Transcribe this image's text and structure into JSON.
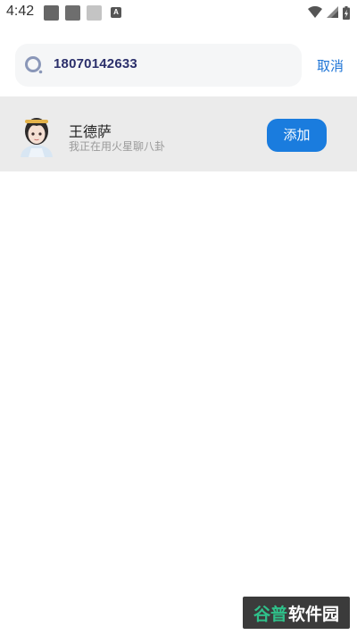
{
  "status_bar": {
    "time": "4:42",
    "notification_badge": "A"
  },
  "search": {
    "query": "18070142633",
    "cancel_label": "取消"
  },
  "result": {
    "name": "王德萨",
    "signature": "我正在用火星聊八卦",
    "add_label": "添加"
  },
  "watermark": {
    "part1": "谷普",
    "part2": "软件园"
  },
  "colors": {
    "accent": "#1a7cde",
    "cancel_text": "#1d74d6",
    "query_text": "#2b2f6b",
    "row_background": "#ebebeb"
  }
}
